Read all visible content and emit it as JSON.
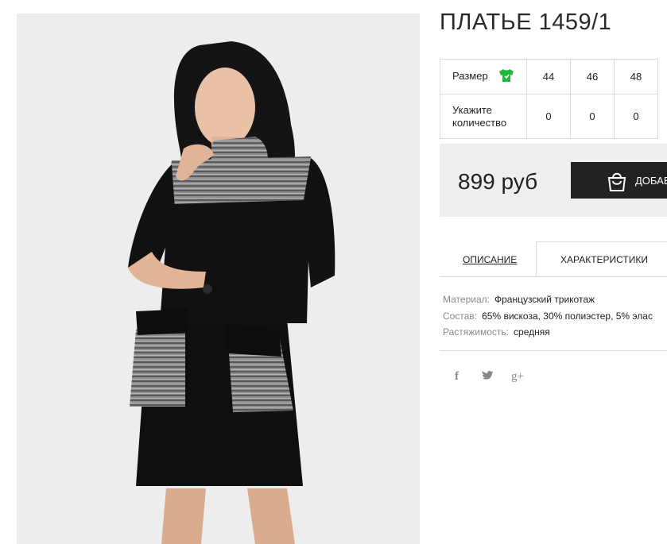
{
  "product": {
    "title": "ПЛАТЬЕ 1459/1",
    "price": "899 руб",
    "add_to_cart_label": "ДОБАВ"
  },
  "size_table": {
    "size_label": "Размер",
    "qty_label": "Укажите количество",
    "sizes": [
      "44",
      "46",
      "48"
    ],
    "quantities": [
      "0",
      "0",
      "0"
    ]
  },
  "tabs": [
    {
      "label": "ОПИСАНИЕ",
      "active": false
    },
    {
      "label": "ХАРАКТЕРИСТИКИ",
      "active": true
    }
  ],
  "specs": [
    {
      "key": "Материал:",
      "value": "Французский трикотаж"
    },
    {
      "key": "Состав:",
      "value": "65% вискоза, 30% полиэстер, 5% элас"
    },
    {
      "key": "Растяжимость:",
      "value": "средняя"
    }
  ],
  "social": [
    {
      "icon": "facebook-icon",
      "glyph": "f"
    },
    {
      "icon": "twitter-icon",
      "glyph": "🐦"
    },
    {
      "icon": "google-plus-icon",
      "glyph": "g+"
    }
  ],
  "colors": {
    "tshirt_icon": "#1fb83a",
    "button_bg": "#222222",
    "price_box_bg": "#eeeeee"
  }
}
